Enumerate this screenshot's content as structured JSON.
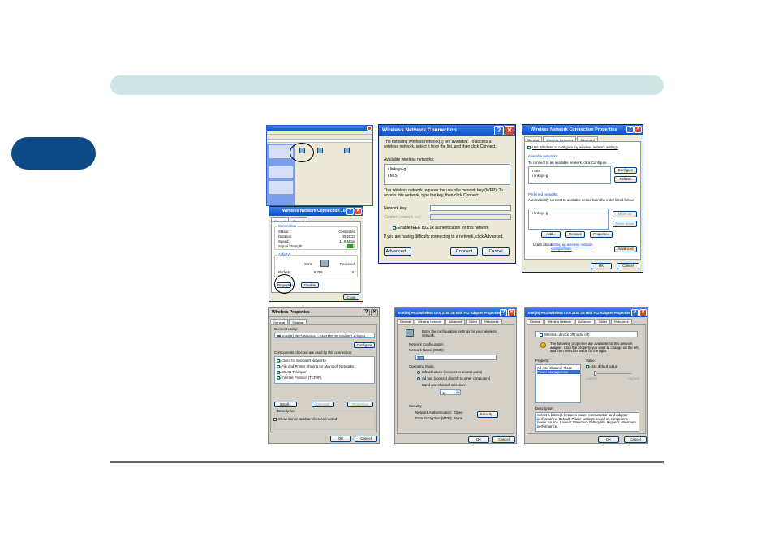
{
  "page": {
    "tab_color": "#0d4a86",
    "bar_color": "#cfe5e3"
  },
  "network_connections": {},
  "status": {
    "title": "Wireless Network Connection 10 Status",
    "tabs": [
      "General",
      "Support"
    ],
    "connection_header": "Connection",
    "rows": [
      {
        "label": "Status:",
        "value": "Connected"
      },
      {
        "label": "Duration:",
        "value": "00:40:23"
      },
      {
        "label": "Speed:",
        "value": "11.0 Mbps"
      },
      {
        "label": "Signal Strength:",
        "value": ""
      }
    ],
    "activity_header": "Activity",
    "sent_label": "Sent",
    "received_label": "Received",
    "packets_label": "Packets:",
    "packets_sent": "8,795",
    "packets_received": "0",
    "properties_btn": "Properties",
    "disable_btn": "Disable",
    "close_btn": "Close"
  },
  "wnc": {
    "title": "Wireless Network Connection",
    "intro": "The following wireless network(s) are available. To access a wireless network, select it from the list, and then click Connect.",
    "available_label": "Available wireless networks:",
    "networks": [
      "linksys-g",
      "MIS"
    ],
    "wep_text": "This wireless network requires the use of a network key (WEP). To access this network, type the key, then click Connect.",
    "key_label": "Network key:",
    "confirm_label": "Confirm network key:",
    "ieee_label": "Enable IEEE 802.1x authentication for this network",
    "help_text": "If you are having difficulty connecting to a network, click Advanced.",
    "advanced_btn": "Advanced...",
    "connect_btn": "Connect",
    "cancel_btn": "Cancel"
  },
  "wncp": {
    "title": "Wireless Network Connection Properties",
    "tabs": [
      "General",
      "Wireless Networks",
      "Advanced"
    ],
    "use_windows": "Use Windows to configure my wireless network settings",
    "available_header": "Available networks:",
    "available_text": "To connect to an available network, click Configure.",
    "available": [
      "MIS",
      "linksys-g"
    ],
    "configure_btn": "Configure",
    "refresh_btn": "Refresh",
    "preferred_header": "Preferred networks:",
    "preferred_text": "Automatically connect to available networks in the order listed below:",
    "preferred": [
      "linksys-g"
    ],
    "move_up_btn": "Move up",
    "move_down_btn": "Move down",
    "add_btn": "Add...",
    "remove_btn": "Remove",
    "properties_btn": "Properties",
    "learn_text": "Learn about",
    "learn_link": "setting up wireless network configuration.",
    "advanced_btn": "Advanced",
    "ok_btn": "OK",
    "cancel_btn": "Cancel"
  },
  "wp": {
    "title": "Wireless Properties",
    "tabs": [
      "General",
      "Sharing"
    ],
    "connect_using": "Connect using:",
    "adapter": "Intel(R) PRO/Wireless LAN 2100 3B Mini PCI Adapter",
    "configure_btn": "Configure",
    "components_label": "Components checked are used by this connection:",
    "components": [
      "Client for Microsoft Networks",
      "File and Printer Sharing for Microsoft Networks",
      "WLAN Transport",
      "Internet Protocol (TCP/IP)"
    ],
    "install_btn": "Install...",
    "uninstall_btn": "Uninstall",
    "properties_btn": "Properties",
    "description_label": "Description",
    "show_icon": "Show icon in taskbar when connected",
    "ok_btn": "OK",
    "cancel_btn": "Cancel"
  },
  "ap1": {
    "title": "Intel(R) PRO/Wireless LAN 2100 3B Mini PCI Adapter Properties",
    "tabs": [
      "General",
      "Wireless Network",
      "Advanced",
      "Driver",
      "Resources"
    ],
    "intro": "Enter the configuration settings for your wireless network.",
    "netconf": "Network Configuration",
    "ssid_label": "Network Name (SSID):",
    "ssid": "MIS",
    "opmode": "Operating Mode",
    "mode1": "Infrastructure (connect to access point)",
    "mode2": "Ad hoc (connect directly to other computers)",
    "band_label": "Band and channel selection:",
    "channel": "11",
    "security": "Security",
    "auth_label": "Network Authentication:",
    "auth_value": "Open",
    "enc_label": "Data Encryption (WEP):",
    "enc_value": "None",
    "security_btn": "Security...",
    "ok_btn": "OK",
    "cancel_btn": "Cancel"
  },
  "ap2": {
    "title": "Intel(R) PRO/Wireless LAN 2100 3B Mini PCI Adapter Properties",
    "tabs": [
      "General",
      "Wireless Network",
      "Advanced",
      "Driver",
      "Resources"
    ],
    "radio_off": "Wireless device off (radio off)",
    "intro": "The following properties are available for this network adapter. Click the property you want to change on the left, and then select its value on the right.",
    "property_label": "Property:",
    "properties": [
      "Ad Hoc Channel Mode",
      "Power Management"
    ],
    "value_label": "Value:",
    "use_default": "Use default value",
    "lowest": "Lowest",
    "highest": "Highest",
    "description_label": "Description:",
    "description": "Select a balance between power consumption and adapter performance. Default: Power settings based on computer's power source. Lowest: Maximum battery life. Highest: Maximum performance.",
    "ok_btn": "OK",
    "cancel_btn": "Cancel"
  }
}
